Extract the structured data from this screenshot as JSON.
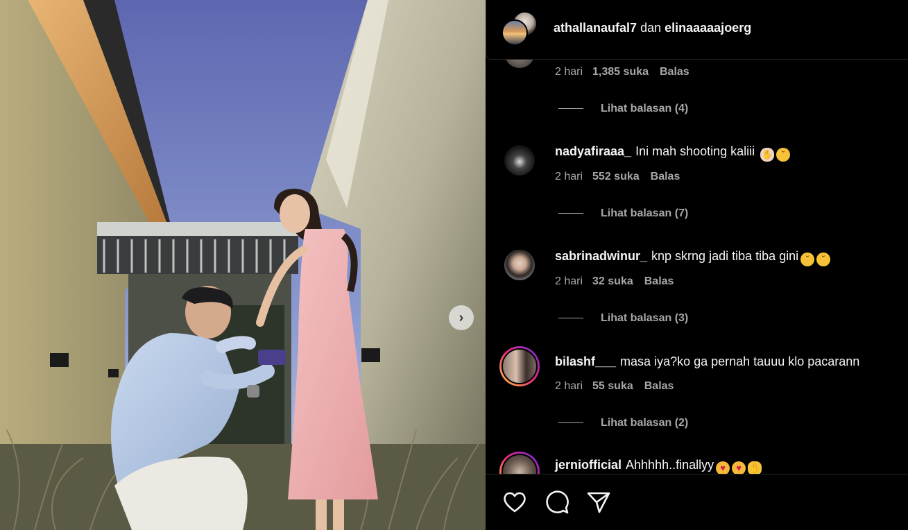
{
  "header": {
    "user1": "athallanaufal7",
    "conjunction": "dan",
    "user2": "elinaaaaajoerg"
  },
  "comments_top": {
    "time": "2 hari",
    "likes": "1,385 suka",
    "reply": "Balas",
    "view_replies": "Lihat balasan (4)"
  },
  "comments": [
    {
      "username": "nadyafiraaa_",
      "text": "Ini mah shooting kaliii",
      "emojis": [
        "hand",
        "sob"
      ],
      "time": "2 hari",
      "likes": "552 suka",
      "reply": "Balas",
      "view_replies": "Lihat balasan (7)",
      "story_ring": false
    },
    {
      "username": "sabrinadwinur_",
      "text": "knp skrng jadi tiba tiba gini",
      "emojis": [
        "sob",
        "sob"
      ],
      "time": "2 hari",
      "likes": "32 suka",
      "reply": "Balas",
      "view_replies": "Lihat balasan (3)",
      "story_ring": false
    },
    {
      "username": "bilashf___",
      "text": "masa iya?ko ga pernah tauuu klo pacarann",
      "emojis": [],
      "time": "2 hari",
      "likes": "55 suka",
      "reply": "Balas",
      "view_replies": "Lihat balasan (2)",
      "story_ring": true
    },
    {
      "username": "jerniofficial",
      "text": "Ahhhhh..finallyy",
      "emojis": [
        "love",
        "love",
        "clap"
      ],
      "story_ring": true
    }
  ],
  "actions": {
    "like_icon": "heart-icon",
    "comment_icon": "comment-icon",
    "share_icon": "send-icon"
  },
  "colors": {
    "background": "#000000",
    "text": "#f5f5f5",
    "secondary_text": "#a8a8a8",
    "divider": "#262626"
  }
}
